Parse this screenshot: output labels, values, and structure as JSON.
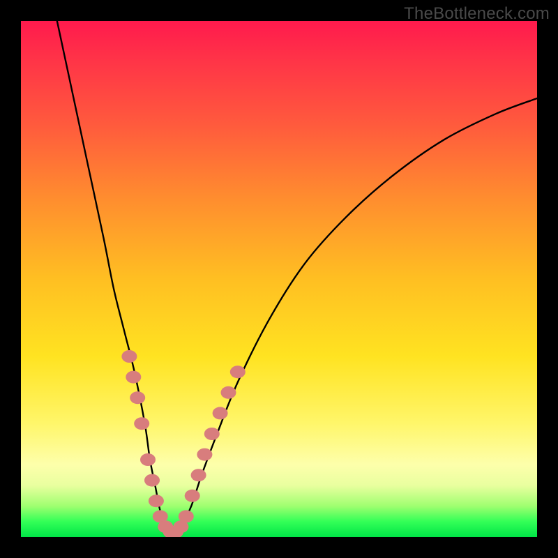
{
  "watermark": "TheBottleneck.com",
  "chart_data": {
    "type": "line",
    "title": "",
    "xlabel": "",
    "ylabel": "",
    "xlim": [
      0,
      100
    ],
    "ylim": [
      0,
      100
    ],
    "series": [
      {
        "name": "bottleneck-curve",
        "x": [
          7,
          10,
          13,
          16,
          18,
          20,
          22,
          24,
          25,
          26,
          27,
          28,
          29,
          30,
          31,
          33,
          35,
          38,
          42,
          48,
          55,
          63,
          72,
          82,
          92,
          100
        ],
        "y": [
          100,
          86,
          72,
          58,
          48,
          40,
          32,
          22,
          15,
          10,
          5,
          2,
          1,
          1,
          2,
          6,
          12,
          20,
          30,
          42,
          53,
          62,
          70,
          77,
          82,
          85
        ]
      }
    ],
    "markers": {
      "name": "highlight-dots",
      "color": "#d87d7d",
      "points": [
        {
          "x": 21.0,
          "y": 35
        },
        {
          "x": 21.8,
          "y": 31
        },
        {
          "x": 22.6,
          "y": 27
        },
        {
          "x": 23.4,
          "y": 22
        },
        {
          "x": 24.6,
          "y": 15
        },
        {
          "x": 25.4,
          "y": 11
        },
        {
          "x": 26.2,
          "y": 7
        },
        {
          "x": 27.0,
          "y": 4
        },
        {
          "x": 28.0,
          "y": 2
        },
        {
          "x": 29.0,
          "y": 1
        },
        {
          "x": 30.0,
          "y": 1
        },
        {
          "x": 31.0,
          "y": 2
        },
        {
          "x": 32.0,
          "y": 4
        },
        {
          "x": 33.2,
          "y": 8
        },
        {
          "x": 34.4,
          "y": 12
        },
        {
          "x": 35.6,
          "y": 16
        },
        {
          "x": 37.0,
          "y": 20
        },
        {
          "x": 38.6,
          "y": 24
        },
        {
          "x": 40.2,
          "y": 28
        },
        {
          "x": 42.0,
          "y": 32
        }
      ]
    },
    "gradient_meaning": "background color maps bottleneck severity: red=high, green=low"
  }
}
